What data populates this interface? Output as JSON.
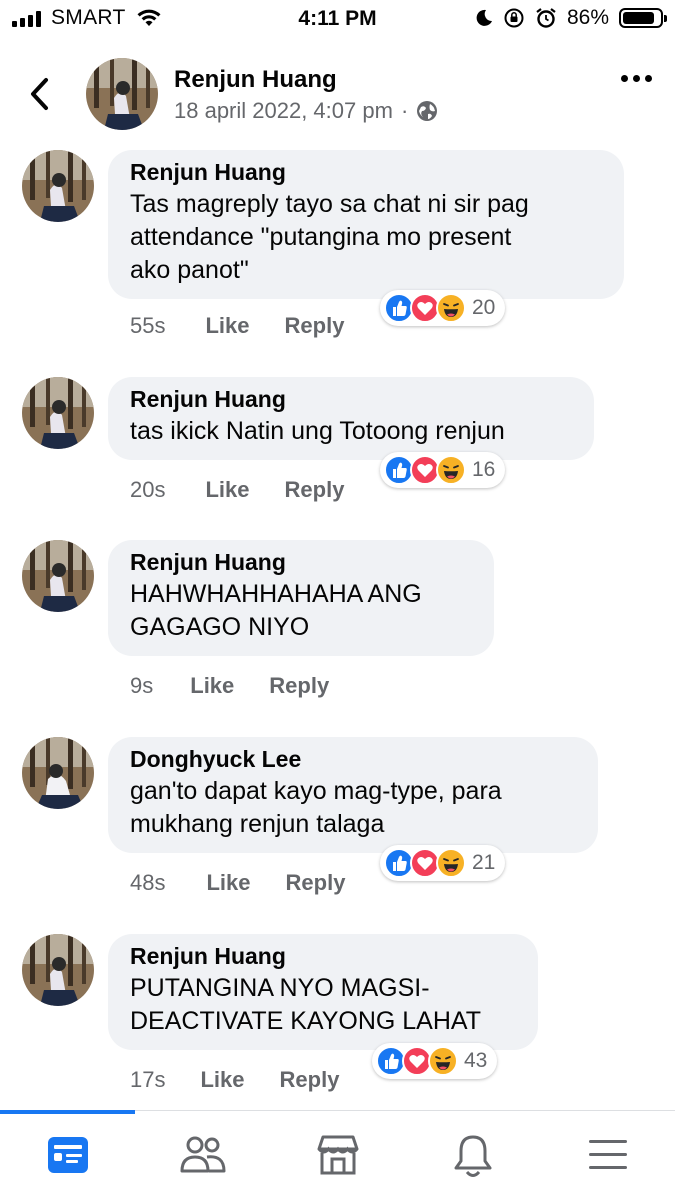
{
  "status_bar": {
    "carrier": "SMART",
    "time": "4:11 PM",
    "battery": "86%",
    "battery_level": 0.86
  },
  "post": {
    "author": "Renjun Huang",
    "timestamp": "18 april 2022, 4:07 pm",
    "separator": "·"
  },
  "comments": [
    {
      "name": "Renjun Huang",
      "lines": [
        "Tas magreply tayo sa chat ni sir pag",
        "attendance \"putangina mo present",
        "ako panot\""
      ],
      "time": "55s",
      "like": "Like",
      "reply": "Reply",
      "reactions": [
        "like-icon",
        "love-icon",
        "haha-icon"
      ],
      "count": "20"
    },
    {
      "name": "Renjun Huang",
      "lines": [
        "tas ikick Natin ung Totoong renjun"
      ],
      "time": "20s",
      "like": "Like",
      "reply": "Reply",
      "reactions": [
        "like-icon",
        "love-icon",
        "haha-icon"
      ],
      "count": "16"
    },
    {
      "name": "Renjun Huang",
      "lines": [
        "HAHWHAHHAHAHA ANG",
        "GAGAGO NIYO"
      ],
      "time": "9s",
      "like": "Like",
      "reply": "Reply",
      "reactions": [],
      "count": ""
    },
    {
      "name": "Donghyuck Lee",
      "lines": [
        "gan'to dapat kayo mag-type, para",
        "mukhang renjun talaga"
      ],
      "time": "48s",
      "like": "Like",
      "reply": "Reply",
      "reactions": [
        "like-icon",
        "love-icon",
        "haha-icon"
      ],
      "count": "21"
    },
    {
      "name": "Renjun Huang",
      "lines": [
        "PUTANGINA NYO MAGSI-",
        "DEACTIVATE KAYONG LAHAT"
      ],
      "time": "17s",
      "like": "Like",
      "reply": "Reply",
      "reactions": [
        "like-icon",
        "love-icon",
        "haha-icon"
      ],
      "count": "43"
    }
  ],
  "bottom_nav": {
    "items": [
      "news-feed-icon",
      "friends-icon",
      "marketplace-icon",
      "notifications-icon",
      "menu-icon"
    ],
    "active": "news-feed-icon",
    "accent": "#1877f2"
  }
}
